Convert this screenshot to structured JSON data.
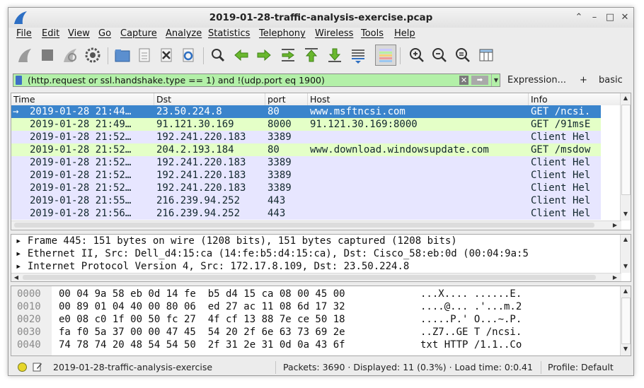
{
  "window": {
    "title": "2019-01-28-traffic-analysis-exercise.pcap",
    "controls": {
      "up": "⌃",
      "minimize": "–",
      "maximize": "□",
      "close": "✕"
    }
  },
  "menu": [
    "File",
    "Edit",
    "View",
    "Go",
    "Capture",
    "Analyze",
    "Statistics",
    "Telephony",
    "Wireless",
    "Tools",
    "Help"
  ],
  "toolbar_icons": [
    "shark-fin-start-icon",
    "stop-icon",
    "restart-icon",
    "capture-options-icon",
    "open-folder-icon",
    "file-icon",
    "close-file-icon",
    "reload-icon",
    "search-icon",
    "back-arrow-icon",
    "forward-arrow-icon",
    "goto-packet-icon",
    "first-packet-icon",
    "last-packet-icon",
    "autoscroll-icon",
    "colorize-icon",
    "zoom-in-icon",
    "zoom-out-icon",
    "normal-size-icon",
    "resize-columns-icon"
  ],
  "filter": {
    "value": "(http.request or ssl.handshake.type == 1) and !(udp.port eq 1900)",
    "expression_label": "Expression...",
    "plus_label": "+",
    "basic_label": "basic"
  },
  "packet_list": {
    "columns": [
      "Time",
      "Dst",
      "port",
      "Host",
      "Info"
    ],
    "rows": [
      {
        "marker": "→",
        "time": "2019-01-28 21:44…",
        "dst": "23.50.224.8",
        "port": "80",
        "host": "www.msftncsi.com",
        "info": "GET /ncsi.",
        "style": "selected"
      },
      {
        "marker": "",
        "time": "2019-01-28 21:49…",
        "dst": "91.121.30.169",
        "port": "8000",
        "host": "91.121.30.169:8000",
        "info": "GET /91msE",
        "style": "http"
      },
      {
        "marker": "",
        "time": "2019-01-28 21:52…",
        "dst": "192.241.220.183",
        "port": "3389",
        "host": "",
        "info": "Client Hel",
        "style": "tls"
      },
      {
        "marker": "",
        "time": "2019-01-28 21:52…",
        "dst": "204.2.193.184",
        "port": "80",
        "host": "www.download.windowsupdate.com",
        "info": "GET /msdow",
        "style": "http"
      },
      {
        "marker": "",
        "time": "2019-01-28 21:52…",
        "dst": "192.241.220.183",
        "port": "3389",
        "host": "",
        "info": "Client Hel",
        "style": "tls"
      },
      {
        "marker": "",
        "time": "2019-01-28 21:52…",
        "dst": "192.241.220.183",
        "port": "3389",
        "host": "",
        "info": "Client Hel",
        "style": "tls"
      },
      {
        "marker": "",
        "time": "2019-01-28 21:52…",
        "dst": "192.241.220.183",
        "port": "3389",
        "host": "",
        "info": "Client Hel",
        "style": "tls"
      },
      {
        "marker": "",
        "time": "2019-01-28 21:55…",
        "dst": "216.239.94.252",
        "port": "443",
        "host": "",
        "info": "Client Hel",
        "style": "tls"
      },
      {
        "marker": "",
        "time": "2019-01-28 21:56…",
        "dst": "216.239.94.252",
        "port": "443",
        "host": "",
        "info": "Client Hel",
        "style": "tls"
      }
    ]
  },
  "details": [
    "Frame 445: 151 bytes on wire (1208 bits), 151 bytes captured (1208 bits)",
    "Ethernet II, Src: Dell_d4:15:ca (14:fe:b5:d4:15:ca), Dst: Cisco_58:eb:0d (00:04:9a:5",
    "Internet Protocol Version 4, Src: 172.17.8.109, Dst: 23.50.224.8"
  ],
  "bytes": [
    {
      "offset": "0000",
      "hex": "00 04 9a 58 eb 0d 14 fe  b5 d4 15 ca 08 00 45 00",
      "ascii": "...X.... ......E."
    },
    {
      "offset": "0010",
      "hex": "00 89 01 04 40 00 80 06  ed 27 ac 11 08 6d 17 32",
      "ascii": "....@... .'...m.2"
    },
    {
      "offset": "0020",
      "hex": "e0 08 c0 1f 00 50 fc 27  4f cf 13 88 7e ce 50 18",
      "ascii": ".....P.' O...~.P."
    },
    {
      "offset": "0030",
      "hex": "fa f0 5a 37 00 00 47 45  54 20 2f 6e 63 73 69 2e",
      "ascii": "..Z7..GE T /ncsi."
    },
    {
      "offset": "0040",
      "hex": "74 78 74 20 48 54 54 50  2f 31 2e 31 0d 0a 43 6f",
      "ascii": "txt HTTP /1.1..Co"
    }
  ],
  "status": {
    "file": "2019-01-28-traffic-analysis-exercise",
    "packets": "Packets: 3690 · Displayed: 11 (0.3%) · Load time: 0:0.41",
    "profile": "Profile: Default"
  },
  "colors": {
    "selected_bg": "#3a84cc",
    "http_bg": "#e4ffc7",
    "tls_bg": "#e7e6ff",
    "filter_bg": "#b3f0a8"
  }
}
